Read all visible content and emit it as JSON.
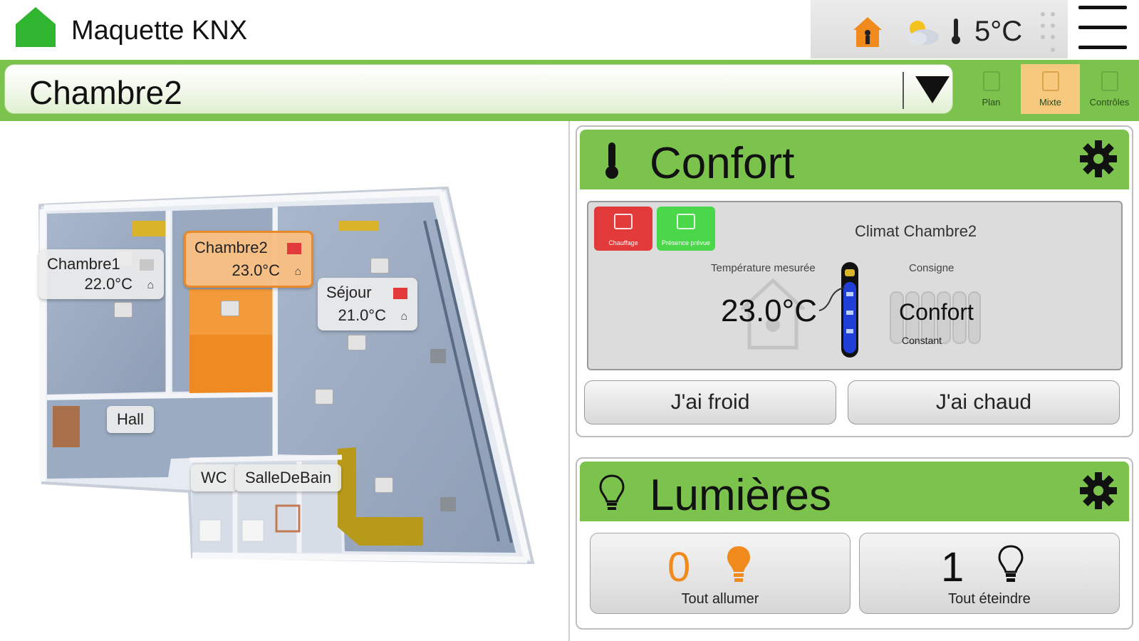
{
  "app": {
    "title": "Maquette KNX"
  },
  "status": {
    "outside_temp": "5°C"
  },
  "room_selector": {
    "selected": "Chambre2"
  },
  "view_tabs": [
    {
      "label": "Plan",
      "active": false
    },
    {
      "label": "Mixte",
      "active": true
    },
    {
      "label": "Contrôles",
      "active": false
    }
  ],
  "plan": {
    "rooms": [
      {
        "name": "Chambre1",
        "temp": "22.0°C"
      },
      {
        "name": "Chambre2",
        "temp": "23.0°C"
      },
      {
        "name": "Séjour",
        "temp": "21.0°C"
      }
    ],
    "hall": "Hall",
    "wc": "WC",
    "sdb": "SalleDeBain"
  },
  "confort": {
    "title": "Confort",
    "mode_buttons": [
      {
        "label": "Chauffage",
        "color": "#e23a3a"
      },
      {
        "label": "Présence prévue",
        "color": "#4ad84a"
      }
    ],
    "climat_name": "Climat Chambre2",
    "measured_label": "Température mesurée",
    "measured_value": "23.0°C",
    "setpoint_label": "Consigne",
    "setpoint_value": "Confort",
    "setpoint_mode": "Constant",
    "cold_button": "J'ai froid",
    "hot_button": "J'ai chaud"
  },
  "lumieres": {
    "title": "Lumières",
    "on": {
      "count": "0",
      "label": "Tout allumer",
      "color": "#f08a1c"
    },
    "off": {
      "count": "1",
      "label": "Tout éteindre",
      "color": "#111111"
    }
  },
  "colors": {
    "accent_green": "#7cc34e",
    "selected_orange": "#e98a2a",
    "status_red": "#e23a3a"
  }
}
